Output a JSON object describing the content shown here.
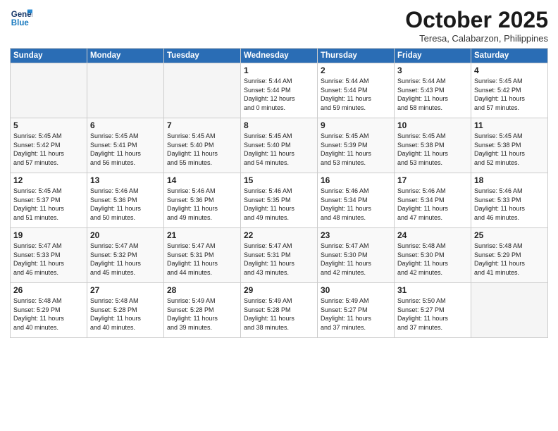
{
  "header": {
    "logo_line1": "General",
    "logo_line2": "Blue",
    "month": "October 2025",
    "location": "Teresa, Calabarzon, Philippines"
  },
  "days_of_week": [
    "Sunday",
    "Monday",
    "Tuesday",
    "Wednesday",
    "Thursday",
    "Friday",
    "Saturday"
  ],
  "weeks": [
    [
      {
        "day": "",
        "info": ""
      },
      {
        "day": "",
        "info": ""
      },
      {
        "day": "",
        "info": ""
      },
      {
        "day": "1",
        "info": "Sunrise: 5:44 AM\nSunset: 5:44 PM\nDaylight: 12 hours\nand 0 minutes."
      },
      {
        "day": "2",
        "info": "Sunrise: 5:44 AM\nSunset: 5:44 PM\nDaylight: 11 hours\nand 59 minutes."
      },
      {
        "day": "3",
        "info": "Sunrise: 5:44 AM\nSunset: 5:43 PM\nDaylight: 11 hours\nand 58 minutes."
      },
      {
        "day": "4",
        "info": "Sunrise: 5:45 AM\nSunset: 5:42 PM\nDaylight: 11 hours\nand 57 minutes."
      }
    ],
    [
      {
        "day": "5",
        "info": "Sunrise: 5:45 AM\nSunset: 5:42 PM\nDaylight: 11 hours\nand 57 minutes."
      },
      {
        "day": "6",
        "info": "Sunrise: 5:45 AM\nSunset: 5:41 PM\nDaylight: 11 hours\nand 56 minutes."
      },
      {
        "day": "7",
        "info": "Sunrise: 5:45 AM\nSunset: 5:40 PM\nDaylight: 11 hours\nand 55 minutes."
      },
      {
        "day": "8",
        "info": "Sunrise: 5:45 AM\nSunset: 5:40 PM\nDaylight: 11 hours\nand 54 minutes."
      },
      {
        "day": "9",
        "info": "Sunrise: 5:45 AM\nSunset: 5:39 PM\nDaylight: 11 hours\nand 53 minutes."
      },
      {
        "day": "10",
        "info": "Sunrise: 5:45 AM\nSunset: 5:38 PM\nDaylight: 11 hours\nand 53 minutes."
      },
      {
        "day": "11",
        "info": "Sunrise: 5:45 AM\nSunset: 5:38 PM\nDaylight: 11 hours\nand 52 minutes."
      }
    ],
    [
      {
        "day": "12",
        "info": "Sunrise: 5:45 AM\nSunset: 5:37 PM\nDaylight: 11 hours\nand 51 minutes."
      },
      {
        "day": "13",
        "info": "Sunrise: 5:46 AM\nSunset: 5:36 PM\nDaylight: 11 hours\nand 50 minutes."
      },
      {
        "day": "14",
        "info": "Sunrise: 5:46 AM\nSunset: 5:36 PM\nDaylight: 11 hours\nand 49 minutes."
      },
      {
        "day": "15",
        "info": "Sunrise: 5:46 AM\nSunset: 5:35 PM\nDaylight: 11 hours\nand 49 minutes."
      },
      {
        "day": "16",
        "info": "Sunrise: 5:46 AM\nSunset: 5:34 PM\nDaylight: 11 hours\nand 48 minutes."
      },
      {
        "day": "17",
        "info": "Sunrise: 5:46 AM\nSunset: 5:34 PM\nDaylight: 11 hours\nand 47 minutes."
      },
      {
        "day": "18",
        "info": "Sunrise: 5:46 AM\nSunset: 5:33 PM\nDaylight: 11 hours\nand 46 minutes."
      }
    ],
    [
      {
        "day": "19",
        "info": "Sunrise: 5:47 AM\nSunset: 5:33 PM\nDaylight: 11 hours\nand 46 minutes."
      },
      {
        "day": "20",
        "info": "Sunrise: 5:47 AM\nSunset: 5:32 PM\nDaylight: 11 hours\nand 45 minutes."
      },
      {
        "day": "21",
        "info": "Sunrise: 5:47 AM\nSunset: 5:31 PM\nDaylight: 11 hours\nand 44 minutes."
      },
      {
        "day": "22",
        "info": "Sunrise: 5:47 AM\nSunset: 5:31 PM\nDaylight: 11 hours\nand 43 minutes."
      },
      {
        "day": "23",
        "info": "Sunrise: 5:47 AM\nSunset: 5:30 PM\nDaylight: 11 hours\nand 42 minutes."
      },
      {
        "day": "24",
        "info": "Sunrise: 5:48 AM\nSunset: 5:30 PM\nDaylight: 11 hours\nand 42 minutes."
      },
      {
        "day": "25",
        "info": "Sunrise: 5:48 AM\nSunset: 5:29 PM\nDaylight: 11 hours\nand 41 minutes."
      }
    ],
    [
      {
        "day": "26",
        "info": "Sunrise: 5:48 AM\nSunset: 5:29 PM\nDaylight: 11 hours\nand 40 minutes."
      },
      {
        "day": "27",
        "info": "Sunrise: 5:48 AM\nSunset: 5:28 PM\nDaylight: 11 hours\nand 40 minutes."
      },
      {
        "day": "28",
        "info": "Sunrise: 5:49 AM\nSunset: 5:28 PM\nDaylight: 11 hours\nand 39 minutes."
      },
      {
        "day": "29",
        "info": "Sunrise: 5:49 AM\nSunset: 5:28 PM\nDaylight: 11 hours\nand 38 minutes."
      },
      {
        "day": "30",
        "info": "Sunrise: 5:49 AM\nSunset: 5:27 PM\nDaylight: 11 hours\nand 37 minutes."
      },
      {
        "day": "31",
        "info": "Sunrise: 5:50 AM\nSunset: 5:27 PM\nDaylight: 11 hours\nand 37 minutes."
      },
      {
        "day": "",
        "info": ""
      }
    ]
  ]
}
